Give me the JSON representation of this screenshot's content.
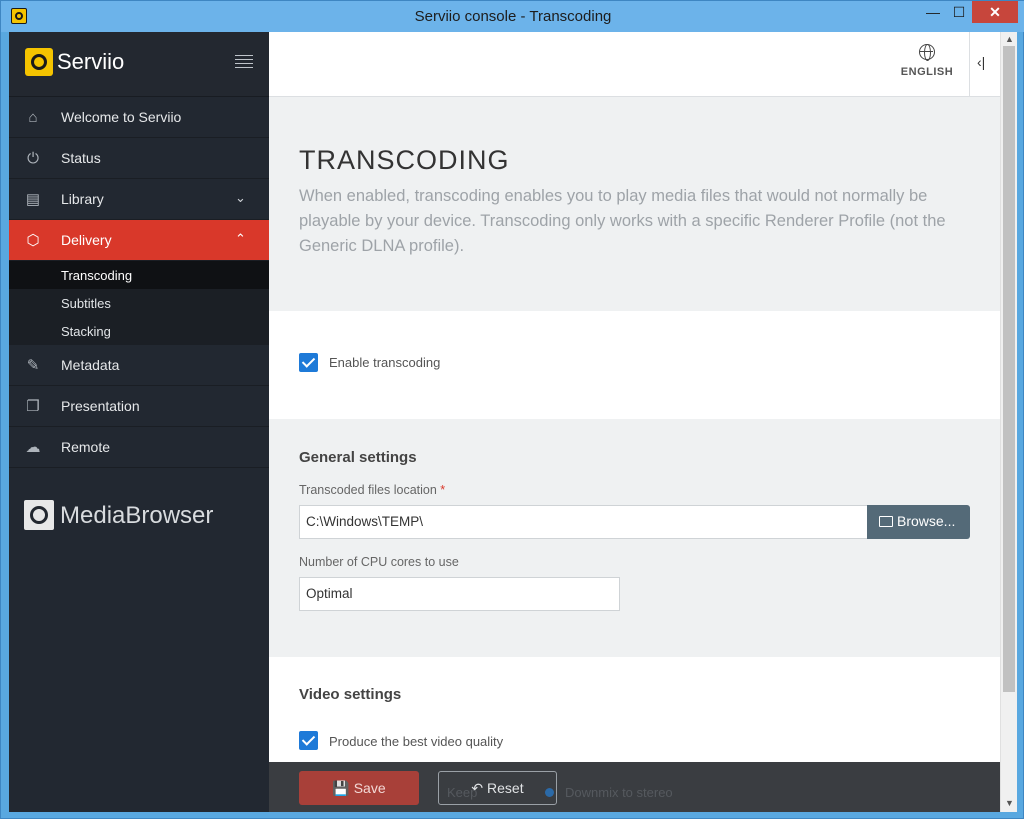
{
  "window": {
    "title": "Serviio console - Transcoding",
    "min": "—",
    "max": "☐",
    "close": "✕"
  },
  "sidebar": {
    "brand": "Serviio",
    "items": [
      {
        "label": "Welcome to Serviio",
        "icon": "⌂"
      },
      {
        "label": "Status",
        "icon": "⏻"
      },
      {
        "label": "Library",
        "icon": "▤",
        "chevron": "⌄"
      },
      {
        "label": "Delivery",
        "icon": "⬡",
        "chevron": "⌃",
        "active": true
      },
      {
        "label": "Metadata",
        "icon": "✎"
      },
      {
        "label": "Presentation",
        "icon": "❐"
      },
      {
        "label": "Remote",
        "icon": "☁"
      }
    ],
    "subitems": [
      "Transcoding",
      "Subtitles",
      "Stacking"
    ],
    "media_browser": "MediaBrowser"
  },
  "topbar": {
    "language": "ENGLISH",
    "collapse": "‹|"
  },
  "hero": {
    "title": "TRANSCODING",
    "description": "When enabled, transcoding enables you to play media files that would not normally be playable by your device. Transcoding only works with a specific Renderer Profile (not the Generic DLNA profile)."
  },
  "enable": {
    "label": "Enable transcoding",
    "checked": true
  },
  "general": {
    "title": "General settings",
    "location_label": "Transcoded files location",
    "required_mark": "*",
    "location_value": "C:\\Windows\\TEMP\\",
    "browse_label": "Browse...",
    "cores_label": "Number of CPU cores to use",
    "cores_value": "Optimal"
  },
  "video": {
    "title": "Video settings",
    "best_quality_label": "Produce the best video quality",
    "best_quality_checked": true
  },
  "footer": {
    "save": "Save",
    "reset": "Reset",
    "ghost_left": "Keep",
    "ghost_right": "Downmix to stereo"
  }
}
